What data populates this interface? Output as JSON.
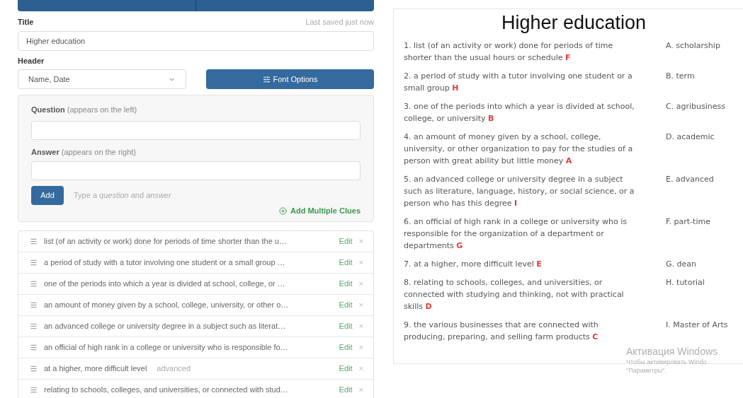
{
  "title_field": {
    "label": "Title",
    "status": "Last saved just now",
    "value": "Higher education"
  },
  "header_field": {
    "label": "Header",
    "value": "Name, Date"
  },
  "font_options_button": {
    "label": "Font Options"
  },
  "clue_form": {
    "question_label": "Question",
    "question_hint": "(appears on the left)",
    "answer_label": "Answer",
    "answer_hint": "(appears on the right)",
    "add_button": "Add",
    "hint_parts": [
      "Type a ",
      "question",
      " and ",
      "answer"
    ],
    "add_multiple": "Add Multiple Clues"
  },
  "clues": [
    {
      "text": "list (of an activity or work) done for periods of time shorter than the u…",
      "edit": "Edit",
      "remove": "×"
    },
    {
      "text": "a period of study with a tutor involving one student or a small group  …",
      "edit": "Edit",
      "remove": "×"
    },
    {
      "text": "one of the periods into which a year is divided at school, college, or …",
      "edit": "Edit",
      "remove": "×"
    },
    {
      "text": "an amount of money given by a school, college, university, or other o…",
      "edit": "Edit",
      "remove": "×"
    },
    {
      "text": "an advanced college or university degree in a subject such as literat…",
      "edit": "Edit",
      "remove": "×"
    },
    {
      "text": "an official of high rank in a college or university who is responsible fo…",
      "edit": "Edit",
      "remove": "×"
    },
    {
      "text": "at a higher, more difficult level",
      "answer": "advanced",
      "edit": "Edit",
      "remove": "×"
    },
    {
      "text": "relating to schools, colleges, and universities, or connected with stud…",
      "edit": "Edit",
      "remove": "×"
    }
  ],
  "preview": {
    "title": "Higher education",
    "questions": [
      {
        "text": "1. list (of an activity or work) done for periods of time shorter than the usual hours or schedule",
        "answer": "F",
        "option": "A. scholarship"
      },
      {
        "text": "2. a period of study with a tutor involving one student or a small group",
        "answer": "H",
        "option": "B. term"
      },
      {
        "text": "3. one of the periods into which a year is divided at school, college, or university",
        "answer": "B",
        "option": "C. agribusiness"
      },
      {
        "text": "4. an amount of money given by a school, college, university, or other organization to pay for the studies of a person with great ability but little money",
        "answer": "A",
        "option": "D. academic"
      },
      {
        "text": "5. an advanced college or university degree in a subject such as literature, language, history, or social science, or a person who has this degree",
        "answer": "I",
        "option": "E. advanced"
      },
      {
        "text": "6. an official of high rank in a college or university who is responsible for the organization of a department or departments",
        "answer": "G",
        "option": "F. part-time"
      },
      {
        "text": "7. at a higher, more difficult level",
        "answer": "E",
        "option": "G. dean"
      },
      {
        "text": "8. relating to schools, colleges, and universities, or connected with studying and thinking, not with practical skills",
        "answer": "D",
        "option": "H. tutorial"
      },
      {
        "text": "9. the various businesses that are connected with producing, preparing, and selling farm products",
        "answer": "C",
        "option": "I. Master of Arts"
      }
    ]
  },
  "os_overlay": {
    "title": "Активация Windows",
    "line_1": "Чтобы активировать Windo",
    "line_2": "\"Параметры\"."
  }
}
